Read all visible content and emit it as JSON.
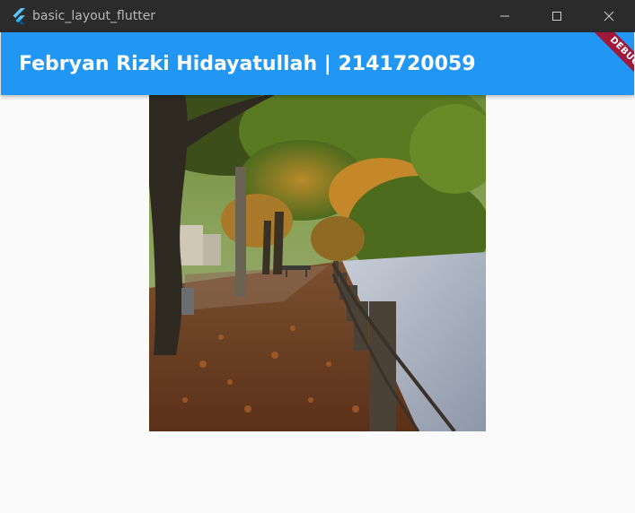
{
  "window": {
    "title": "basic_layout_flutter",
    "icon": "flutter-logo-icon",
    "controls": [
      "minimize-icon",
      "maximize-icon",
      "close-icon"
    ]
  },
  "appbar": {
    "title": "Febryan Rizki Hidayatullah | 2141720059",
    "color": "#2196f3"
  },
  "debug_banner": {
    "label": "DEBUG",
    "color": "#a0193a"
  },
  "content": {
    "image": "autumn-riverside-path-photo"
  }
}
